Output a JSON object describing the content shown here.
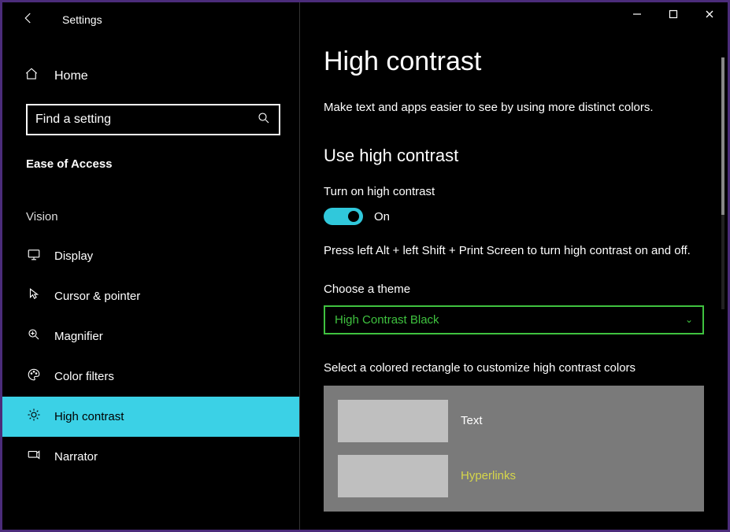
{
  "header": {
    "title": "Settings"
  },
  "sidebar": {
    "home_label": "Home",
    "search_placeholder": "Find a setting",
    "category": "Ease of Access",
    "section": "Vision",
    "items": [
      {
        "label": "Display"
      },
      {
        "label": "Cursor & pointer"
      },
      {
        "label": "Magnifier"
      },
      {
        "label": "Color filters"
      },
      {
        "label": "High contrast"
      },
      {
        "label": "Narrator"
      }
    ]
  },
  "content": {
    "title": "High contrast",
    "description": "Make text and apps easier to see by using more distinct colors.",
    "use_section": "Use high contrast",
    "toggle_caption": "Turn on high contrast",
    "toggle_value": "On",
    "shortcut_hint": "Press left Alt + left Shift + Print Screen to turn high contrast on and off.",
    "theme_label": "Choose a theme",
    "theme_value": "High Contrast Black",
    "customize_label": "Select a colored rectangle to customize high contrast colors",
    "colors": [
      {
        "label": "Text",
        "class": "text"
      },
      {
        "label": "Hyperlinks",
        "class": "hyperlink"
      }
    ]
  }
}
